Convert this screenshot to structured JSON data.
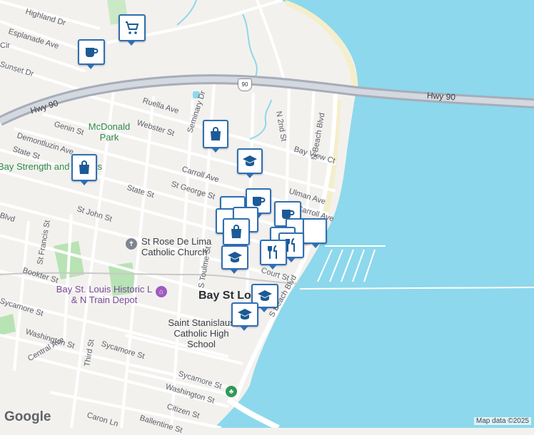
{
  "map": {
    "colors": {
      "water": "#8dd8ec",
      "land": "#f3f1ee",
      "road": "#ffffff",
      "highway": "#9fa6b5",
      "park": "#b8e3b4",
      "sand": "#f5eecb",
      "pin_border": "#2f6fb5"
    },
    "street_labels": [
      "Highland Dr",
      "Esplanade Ave",
      "Cir",
      "Sunset Dr",
      "Ruella Ave",
      "Seminary Dr",
      "N 2nd St",
      "Webster St",
      "Genin St",
      "Demontluzin Ave",
      "State St",
      "Bay View Ct",
      "Carroll Ave",
      "St George St",
      "State St",
      "Ulman Ave",
      "Carroll Ave",
      "St John St",
      "Blvd",
      "St Francis St",
      "Bookter St",
      "S Toulme St",
      "Court St",
      "S Beach Blvd",
      "N Beach Blvd",
      "Sycamore St",
      "Washington St",
      "Central Ave",
      "Third St",
      "Sycamore St",
      "Sycamore St",
      "Washington St",
      "Citizen St",
      "Caron Ln",
      "Ballentine St"
    ],
    "highway": {
      "label_left": "Hwy 90",
      "label_right": "Hwy 90",
      "shield": "90"
    },
    "places": {
      "park": "McDonald Park",
      "gym": "Bay Strength and Fitness",
      "church": "St Rose De Lima Catholic Church",
      "depot": "Bay St. Louis Historic L & N Train Depot",
      "city": "Bay St Louis",
      "school": "Saint Stanislaus Catholic High School"
    },
    "pins": [
      "cart-icon",
      "coffee-icon",
      "bag-icon",
      "bag-icon",
      "graduation-cap-icon",
      "coffee-icon",
      "coffee-icon",
      "bag-icon",
      "graduation-cap-icon",
      "restaurant-icon",
      "restaurant-icon",
      "graduation-cap-icon",
      "graduation-cap-icon"
    ],
    "logo": "Google",
    "attribution": "Map data ©2025"
  }
}
